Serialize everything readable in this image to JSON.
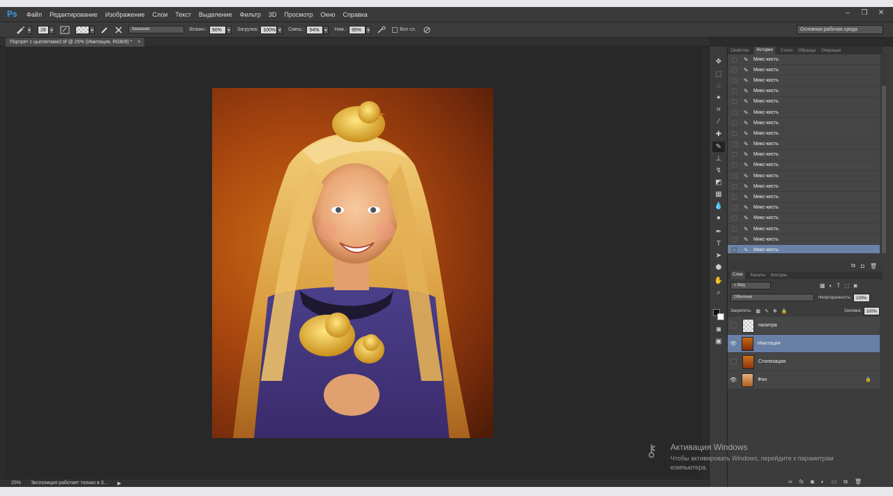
{
  "app": {
    "logo": "Ps"
  },
  "menu": [
    "Файл",
    "Редактирование",
    "Изображение",
    "Слои",
    "Текст",
    "Выделение",
    "Фильтр",
    "3D",
    "Просмотр",
    "Окно",
    "Справка"
  ],
  "window_controls": {
    "minimize": "–",
    "restore": "❐",
    "close": "✕"
  },
  "options_bar": {
    "brush_size": "28",
    "mode_select": "Заказная",
    "wet_label": "Влажн.:",
    "wet_value": "90%",
    "load_label": "Загрузка:",
    "load_value": "100%",
    "mix_label": "Смеш.:",
    "mix_value": "54%",
    "flow_label": "Наж.:",
    "flow_value": "95%",
    "all_layers": "Все сл.",
    "workspace": "Основная рабочая среда"
  },
  "document_tab": {
    "title": "Портрет с цыплятами2.tif @ 25% (Имитация, RGB/8) *"
  },
  "status": {
    "zoom": "25%",
    "info": "Экспозиция работает только в 3..."
  },
  "history_panel": {
    "tabs": [
      "Свойства",
      "История",
      "Стили",
      "Образцы",
      "Операции"
    ],
    "active_tab": "История",
    "items": [
      "Микс-кисть",
      "Микс-кисть",
      "Микс-кисть",
      "Микс-кисть",
      "Микс-кисть",
      "Микс-кисть",
      "Микс-кисть",
      "Микс-кисть",
      "Микс-кисть",
      "Микс-кисть",
      "Микс-кисть",
      "Микс-кисть",
      "Микс-кисть",
      "Микс-кисть",
      "Микс-кисть",
      "Микс-кисть",
      "Микс-кисть",
      "Микс-кисть",
      "Микс-кисть"
    ],
    "selected_index": 18
  },
  "layers_panel": {
    "tabs": [
      "Слои",
      "Каналы",
      "Контуры"
    ],
    "active_tab": "Слои",
    "filter_kind": "Вид",
    "blend_mode": "Обычные",
    "opacity_label": "Непрозрачность:",
    "opacity_value": "100%",
    "lock_label": "Закрепить:",
    "fill_label": "Заливка:",
    "fill_value": "100%",
    "layers": [
      {
        "name": "палитра",
        "visible": false,
        "selected": false
      },
      {
        "name": "Имитация",
        "visible": true,
        "selected": true
      },
      {
        "name": "Стилизация",
        "visible": false,
        "selected": false
      },
      {
        "name": "Фон",
        "visible": true,
        "selected": false,
        "locked": true
      }
    ]
  },
  "watermark": {
    "title": "Активация Windows",
    "subtitle": "Чтобы активировать Windows, перейдите к параметрам компьютера."
  }
}
